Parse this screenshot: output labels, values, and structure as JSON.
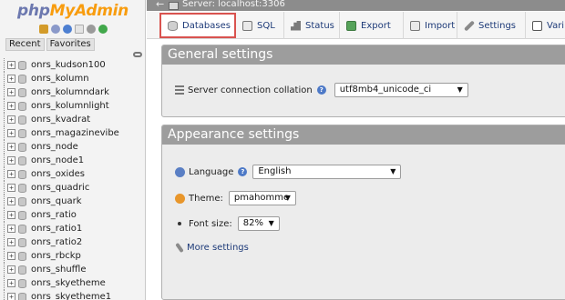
{
  "logo": {
    "part1": "php",
    "part2": "MyAdmin"
  },
  "quick_icons": [
    "home-icon",
    "exit-icon",
    "info-icon",
    "documentation-icon",
    "settings-icon",
    "reload-icon"
  ],
  "nav": {
    "recent_label": "Recent",
    "favorites_label": "Favorites",
    "databases": [
      "onrs_kudson100",
      "onrs_kolumn",
      "onrs_kolumndark",
      "onrs_kolumnlight",
      "onrs_kvadrat",
      "onrs_magazinevibe",
      "onrs_node",
      "onrs_node1",
      "onrs_oxides",
      "onrs_quadric",
      "onrs_quark",
      "onrs_ratio",
      "onrs_ratio1",
      "onrs_ratio2",
      "onrs_rbckp",
      "onrs_shuffle",
      "onrs_skyetheme",
      "onrs_skyetheme1"
    ],
    "expander_symbol": "+"
  },
  "serverbar": {
    "back_symbol": "←",
    "text": "Server: localhost:3306"
  },
  "tabs": {
    "databases": "Databases",
    "sql": "SQL",
    "status": "Status",
    "export": "Export",
    "import": "Import",
    "settings": "Settings",
    "variables": "Vari"
  },
  "general": {
    "title": "General settings",
    "collation_label": "Server connection collation",
    "collation_value": "utf8mb4_unicode_ci"
  },
  "appearance": {
    "title": "Appearance settings",
    "language_label": "Language",
    "language_value": "English",
    "theme_label": "Theme:",
    "theme_value": "pmahomme",
    "fontsize_label": "Font size:",
    "fontsize_value": "82%",
    "more_settings": "More settings"
  },
  "help_symbol": "?",
  "select_arrow": "▼",
  "colors": {
    "logo_php": "#6c78af",
    "logo_myadmin": "#f89c0e",
    "active_tab_border": "#d9534f",
    "panel_title_bg": "#9d9d9d",
    "link": "#1d3a78"
  }
}
